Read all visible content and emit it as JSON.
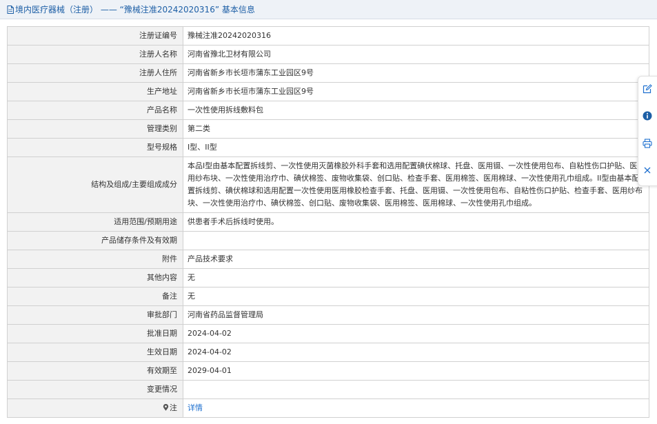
{
  "title": {
    "text": "境内医疗器械（注册） —— “豫械注准20242020316” 基本信息"
  },
  "rows": [
    {
      "label": "注册证编号",
      "value": "豫械注准20242020316"
    },
    {
      "label": "注册人名称",
      "value": "河南省豫北卫材有限公司"
    },
    {
      "label": "注册人住所",
      "value": "河南省新乡市长垣市蒲东工业园区9号"
    },
    {
      "label": "生产地址",
      "value": "河南省新乡市长垣市蒲东工业园区9号"
    },
    {
      "label": "产品名称",
      "value": "一次性使用拆线敷料包"
    },
    {
      "label": "管理类别",
      "value": "第二类"
    },
    {
      "label": "型号规格",
      "value": "I型、II型"
    },
    {
      "label": "结构及组成/主要组成成分",
      "value": "本品I型由基本配置拆线剪、一次性使用灭菌橡胶外科手套和选用配置碘伏棉球、托盘、医用镊、一次性使用包布、自粘性伤口护贴、医用纱布块、一次性使用治疗巾、碘伏棉签、废物收集袋、创口贴、检查手套、医用棉签、医用棉球、一次性使用孔巾组成。II型由基本配置拆线剪、碘伏棉球和选用配置一次性使用医用橡胶检查手套、托盘、医用镊、一次性使用包布、自粘性伤口护贴、检查手套、医用纱布块、一次性使用治疗巾、碘伏棉签、创口贴、废物收集袋、医用棉签、医用棉球、一次性使用孔巾组成。"
    },
    {
      "label": "适用范围/预期用途",
      "value": "供患者手术后拆线时使用。"
    },
    {
      "label": "产品储存条件及有效期",
      "value": ""
    },
    {
      "label": "附件",
      "value": "产品技术要求"
    },
    {
      "label": "其他内容",
      "value": "无"
    },
    {
      "label": "备注",
      "value": "无"
    },
    {
      "label": "审批部门",
      "value": "河南省药品监督管理局"
    },
    {
      "label": "批准日期",
      "value": "2024-04-02"
    },
    {
      "label": "生效日期",
      "value": "2024-04-02"
    },
    {
      "label": "有效期至",
      "value": "2029-04-01"
    },
    {
      "label": "变更情况",
      "value": ""
    },
    {
      "label": "注",
      "value": "详情"
    }
  ],
  "icons": {
    "title": "document-icon",
    "note": "location-pin-icon",
    "side_panel": [
      "edit-icon",
      "info-icon",
      "print-icon",
      "close-icon"
    ]
  },
  "colors": {
    "title_text": "#1d5fa6",
    "label_bg": "#f2f2f2",
    "border": "#d0d0d0",
    "link": "#1d6fcf"
  }
}
